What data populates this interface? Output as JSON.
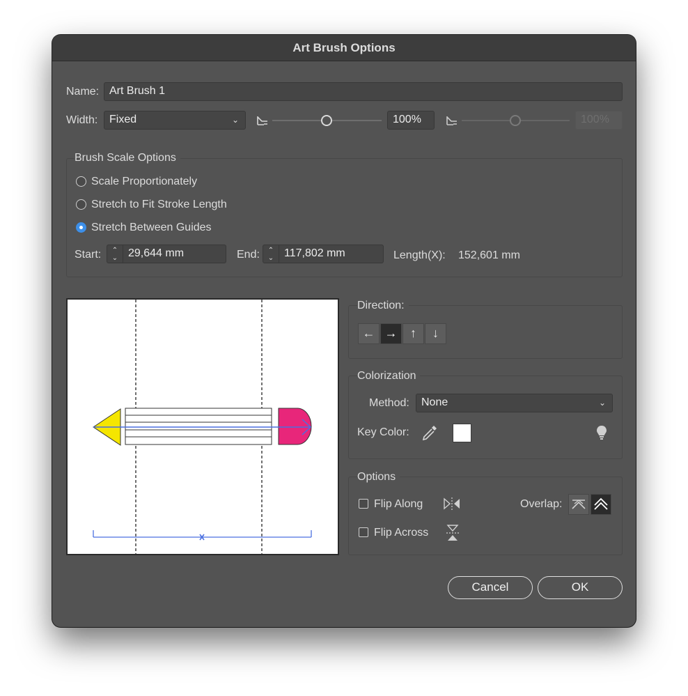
{
  "dialog": {
    "title": "Art Brush Options"
  },
  "name": {
    "label": "Name:",
    "value": "Art Brush 1"
  },
  "width": {
    "label": "Width:",
    "mode": "Fixed",
    "value": "100%",
    "variation_value": "100%"
  },
  "scale_options": {
    "title": "Brush Scale Options",
    "options": [
      "Scale Proportionately",
      "Stretch to Fit Stroke Length",
      "Stretch Between Guides"
    ],
    "selected": "Stretch Between Guides",
    "start_label": "Start:",
    "start_value": "29,644 mm",
    "end_label": "End:",
    "end_value": "117,802 mm",
    "length_label": "Length(X):",
    "length_value": "152,601 mm"
  },
  "direction": {
    "title": "Direction:",
    "buttons": [
      "←",
      "→",
      "↑",
      "↓"
    ],
    "selected": "→"
  },
  "colorization": {
    "title": "Colorization",
    "method_label": "Method:",
    "method_value": "None",
    "key_color_label": "Key Color:",
    "key_color": "#ffffff"
  },
  "options": {
    "title": "Options",
    "flip_along_label": "Flip Along",
    "flip_across_label": "Flip Across",
    "flip_along_checked": false,
    "flip_across_checked": false,
    "overlap_label": "Overlap:"
  },
  "buttons": {
    "cancel": "Cancel",
    "ok": "OK"
  },
  "colors": {
    "dialog_bg": "#535353",
    "accent": "#3d8fe8",
    "pencil_tip": "#f5e600",
    "pencil_eraser": "#e8267a",
    "guide_blue": "#4a6fe0"
  }
}
